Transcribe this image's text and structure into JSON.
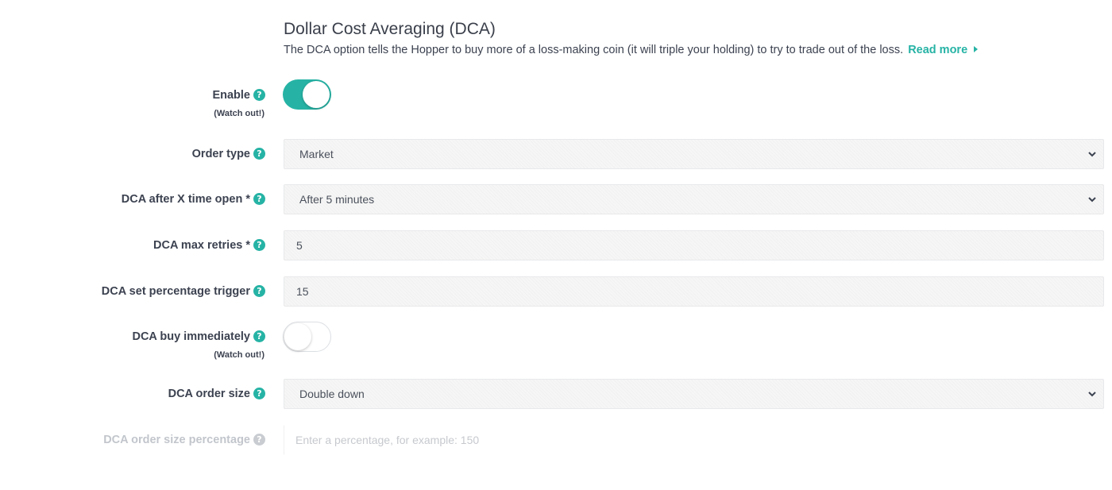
{
  "header": {
    "title": "Dollar Cost Averaging (DCA)",
    "description": "The DCA option tells the Hopper to buy more of a loss-making coin (it will triple your holding) to try to trade out of the loss.",
    "read_more": "Read more"
  },
  "colors": {
    "accent": "#26b3a5",
    "text": "#3c4250",
    "disabled_text": "#c2c6cc"
  },
  "fields": {
    "enable": {
      "label": "Enable",
      "note": "(Watch out!)",
      "help_icon": "question-circle-icon",
      "value": true
    },
    "order_type": {
      "label": "Order type",
      "value": "Market",
      "help_icon": "question-circle-icon"
    },
    "dca_after": {
      "label": "DCA after X time open *",
      "value": "After 5 minutes",
      "help_icon": "question-circle-icon"
    },
    "max_retries": {
      "label": "DCA max retries *",
      "value": "5",
      "help_icon": "question-circle-icon"
    },
    "percentage_trigger": {
      "label": "DCA set percentage trigger",
      "value": "15",
      "help_icon": "question-circle-icon"
    },
    "buy_immediately": {
      "label": "DCA buy immediately",
      "note": "(Watch out!)",
      "help_icon": "question-circle-icon",
      "value": false
    },
    "order_size": {
      "label": "DCA order size",
      "value": "Double down",
      "help_icon": "question-circle-icon"
    },
    "order_size_percentage": {
      "label": "DCA order size percentage",
      "placeholder": "Enter a percentage, for example: 150",
      "value": "",
      "help_icon": "question-circle-icon",
      "disabled": true
    }
  }
}
